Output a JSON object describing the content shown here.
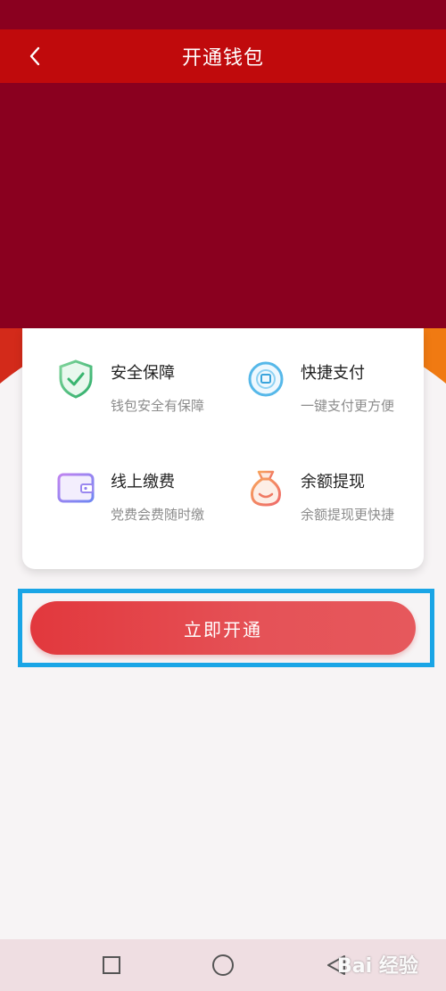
{
  "header": {
    "title": "开通钱包",
    "back_icon": "chevron-left-icon"
  },
  "colors": {
    "header_red": "#c00a0c",
    "banner_crimson": "#8a001f",
    "button_red": "#e2383d",
    "highlight_blue": "#1aa5e6"
  },
  "features": [
    {
      "title": "安全保障",
      "desc": "钱包安全有保障",
      "icon": "shield-check-icon"
    },
    {
      "title": "快捷支付",
      "desc": "一键支付更方便",
      "icon": "quick-pay-icon"
    },
    {
      "title": "线上缴费",
      "desc": "党费会费随时缴",
      "icon": "wallet-icon"
    },
    {
      "title": "余额提现",
      "desc": "余额提现更快捷",
      "icon": "money-bag-icon"
    }
  ],
  "action": {
    "open_label": "立即开通"
  },
  "nav": {
    "icons": [
      "recent-apps-icon",
      "home-icon",
      "back-triangle-icon"
    ]
  },
  "watermark": {
    "text": "Bai 经验"
  }
}
